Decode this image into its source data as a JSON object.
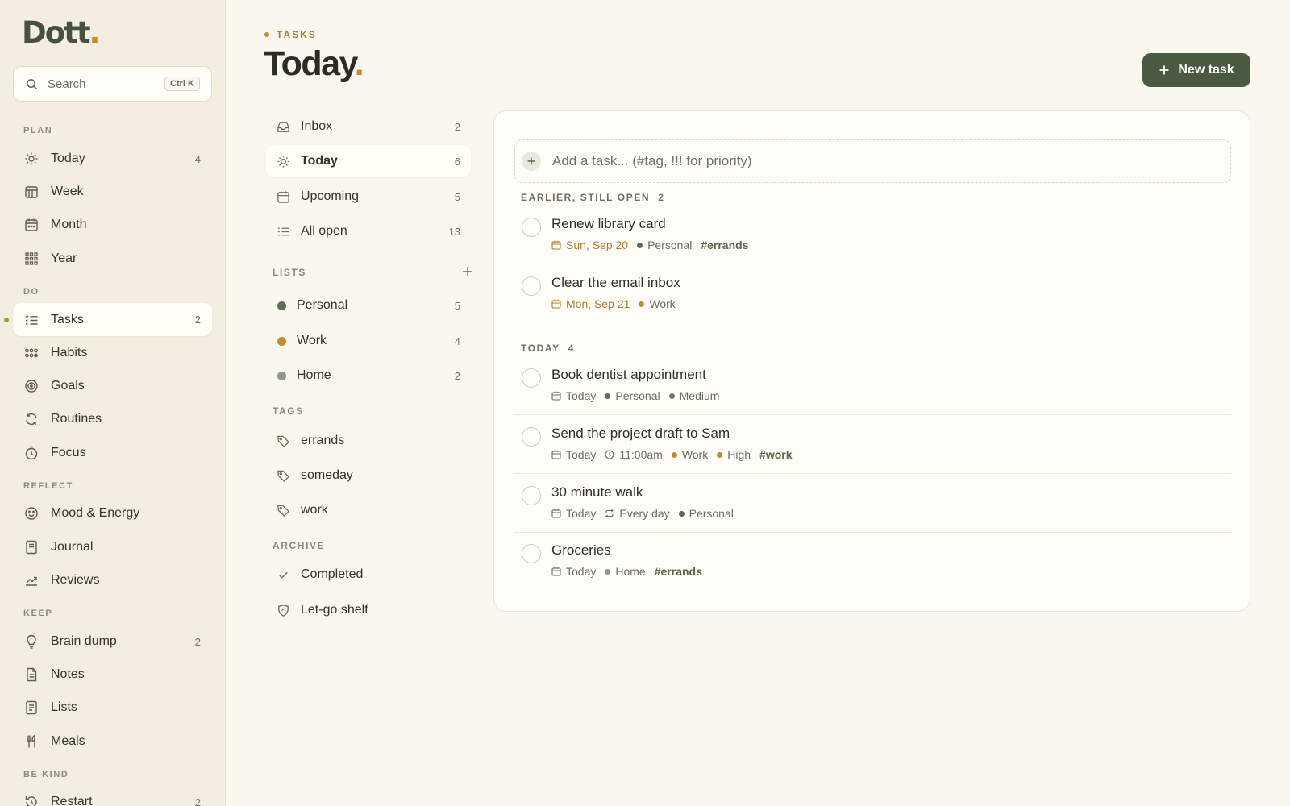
{
  "app": {
    "logo_text": "Dott",
    "logo_dot": "."
  },
  "search": {
    "placeholder": "Search",
    "shortcut": "Ctrl K"
  },
  "sidebar": {
    "sections": {
      "plan": "PLAN",
      "do": "DO",
      "reflect": "REFLECT",
      "keep": "KEEP",
      "be_kind": "BE KIND"
    },
    "items": [
      {
        "label": "Today",
        "count": "4",
        "icon": "sun-icon"
      },
      {
        "label": "Week",
        "count": "",
        "icon": "week-calendar-icon"
      },
      {
        "label": "Month",
        "count": "",
        "icon": "month-calendar-icon"
      },
      {
        "label": "Year",
        "count": "",
        "icon": "year-grid-icon"
      },
      {
        "label": "Tasks",
        "count": "2",
        "icon": "list-checks-icon",
        "active": true
      },
      {
        "label": "Habits",
        "count": "",
        "icon": "habits-dots-icon"
      },
      {
        "label": "Goals",
        "count": "",
        "icon": "target-icon"
      },
      {
        "label": "Routines",
        "count": "",
        "icon": "refresh-icon"
      },
      {
        "label": "Focus",
        "count": "",
        "icon": "timer-icon"
      },
      {
        "label": "Mood & Energy",
        "count": "",
        "icon": "smile-icon"
      },
      {
        "label": "Journal",
        "count": "",
        "icon": "journal-icon"
      },
      {
        "label": "Reviews",
        "count": "",
        "icon": "trend-icon"
      },
      {
        "label": "Brain dump",
        "count": "2",
        "icon": "lightbulb-icon"
      },
      {
        "label": "Notes",
        "count": "",
        "icon": "note-icon"
      },
      {
        "label": "Lists",
        "count": "",
        "icon": "list-doc-icon"
      },
      {
        "label": "Meals",
        "count": "",
        "icon": "utensils-icon"
      },
      {
        "label": "Restart",
        "count": "2",
        "icon": "restart-icon"
      }
    ]
  },
  "header": {
    "eyebrow": "TASKS",
    "title": "Today",
    "title_dot": ".",
    "new_task_label": "New task"
  },
  "views": [
    {
      "label": "Inbox",
      "count": "2",
      "icon": "inbox-icon"
    },
    {
      "label": "Today",
      "count": "6",
      "icon": "sun-icon",
      "active": true
    },
    {
      "label": "Upcoming",
      "count": "5",
      "icon": "calendar-icon"
    },
    {
      "label": "All open",
      "count": "13",
      "icon": "list-icon"
    }
  ],
  "lists": {
    "heading": "LISTS",
    "items": [
      {
        "label": "Personal",
        "count": "5",
        "color": "#5e6e4f"
      },
      {
        "label": "Work",
        "count": "4",
        "color": "#c48a2c"
      },
      {
        "label": "Home",
        "count": "2",
        "color": "#8e998a"
      }
    ]
  },
  "tags": {
    "heading": "TAGS",
    "items": [
      {
        "label": "errands"
      },
      {
        "label": "someday"
      },
      {
        "label": "work"
      }
    ]
  },
  "archive": {
    "heading": "ARCHIVE",
    "items": [
      {
        "label": "Completed",
        "icon": "check-icon"
      },
      {
        "label": "Let-go shelf",
        "icon": "leaf-shield-icon"
      }
    ]
  },
  "composer": {
    "placeholder": "Add a task... (#tag, !!! for priority)"
  },
  "groups": [
    {
      "label": "EARLIER, STILL OPEN",
      "count": "2",
      "tasks": [
        {
          "title": "Renew library card",
          "date": "Sun, Sep 20",
          "list": "Personal",
          "tag": "#errands"
        },
        {
          "title": "Clear the email inbox",
          "date": "Mon, Sep 21",
          "list": "Work"
        }
      ]
    },
    {
      "label": "TODAY",
      "count": "4",
      "tasks": [
        {
          "title": "Book dentist appointment",
          "date": "Today",
          "list": "Personal",
          "priority": "Medium"
        },
        {
          "title": "Send the project draft to Sam",
          "date": "Today",
          "time": "11:00am",
          "list": "Work",
          "priority": "High",
          "tag": "#work"
        },
        {
          "title": "30 minute walk",
          "date": "Today",
          "repeat": "Every day",
          "list": "Personal"
        },
        {
          "title": "Groceries",
          "date": "Today",
          "list": "Home",
          "tag": "#errands"
        }
      ]
    }
  ],
  "colors": {
    "accent": "#c48a2c",
    "primary": "#4a5a40",
    "personal": "#5e6e4f",
    "work": "#c48a2c",
    "home": "#8e998a",
    "medium": "#6b7a5c",
    "high": "#c48a2c"
  }
}
